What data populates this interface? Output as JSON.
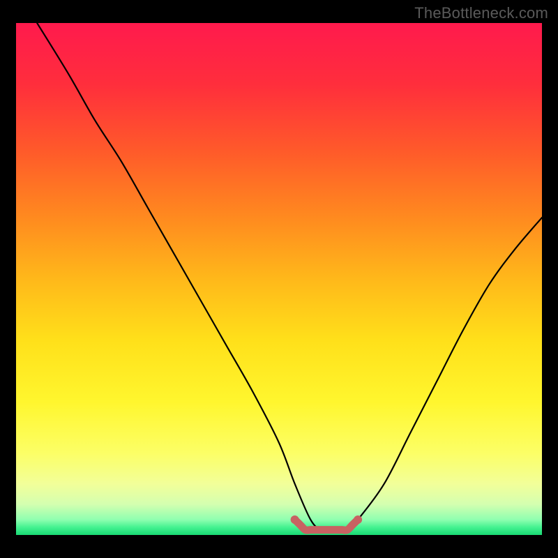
{
  "watermark": "TheBottleneck.com",
  "chart_data": {
    "type": "line",
    "title": "",
    "xlabel": "",
    "ylabel": "",
    "xlim": [
      0,
      100
    ],
    "ylim": [
      0,
      100
    ],
    "grid": false,
    "legend": false,
    "series": [
      {
        "name": "bottleneck-curve",
        "color": "#000000",
        "x": [
          4,
          10,
          15,
          20,
          25,
          30,
          35,
          40,
          45,
          50,
          53,
          56,
          58,
          60,
          63,
          65,
          70,
          75,
          80,
          85,
          90,
          95,
          100
        ],
        "y": [
          100,
          90,
          81,
          73,
          64,
          55,
          46,
          37,
          28,
          18,
          10,
          3,
          1,
          1,
          1,
          3,
          10,
          20,
          30,
          40,
          49,
          56,
          62
        ]
      },
      {
        "name": "minimum-marker",
        "color": "#c86262",
        "x": [
          53,
          54,
          55,
          56,
          57,
          58,
          59,
          60,
          61,
          62,
          63,
          64,
          65
        ],
        "y": [
          3,
          2,
          1,
          1,
          1,
          1,
          1,
          1,
          1,
          1,
          1,
          2,
          3
        ]
      }
    ],
    "background_gradient": {
      "stops": [
        {
          "pos": 0.0,
          "color": "#ff1a4d"
        },
        {
          "pos": 0.12,
          "color": "#ff2e3c"
        },
        {
          "pos": 0.25,
          "color": "#ff5a2a"
        },
        {
          "pos": 0.38,
          "color": "#ff8a1f"
        },
        {
          "pos": 0.5,
          "color": "#ffb81a"
        },
        {
          "pos": 0.62,
          "color": "#ffe01a"
        },
        {
          "pos": 0.74,
          "color": "#fff62e"
        },
        {
          "pos": 0.84,
          "color": "#fcff66"
        },
        {
          "pos": 0.9,
          "color": "#f2ff99"
        },
        {
          "pos": 0.94,
          "color": "#d4ffb0"
        },
        {
          "pos": 0.97,
          "color": "#8fffb0"
        },
        {
          "pos": 0.985,
          "color": "#44f290"
        },
        {
          "pos": 1.0,
          "color": "#18d973"
        }
      ]
    }
  }
}
